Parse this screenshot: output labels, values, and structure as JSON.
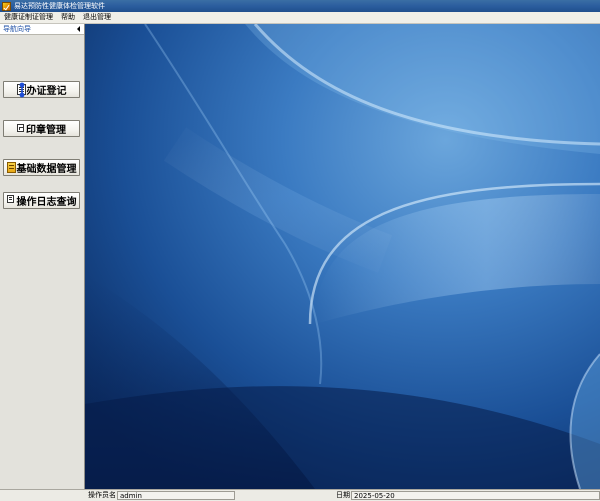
{
  "window": {
    "title": "易达预防性健康体检管理软件",
    "icon": "app-check-icon"
  },
  "menu": {
    "items": [
      {
        "label": "健康证制证管理"
      },
      {
        "label": "帮助"
      },
      {
        "label": "退出管理"
      }
    ]
  },
  "nav": {
    "title": "导航向导",
    "collapse_icon": "collapse-left-icon",
    "buttons": [
      {
        "label": "办证登记",
        "icon": "id-card-icon"
      },
      {
        "label": "印章管理",
        "icon": "stamp-icon"
      },
      {
        "label": "基础数据管理",
        "icon": "database-icon"
      },
      {
        "label": "操作日志查询",
        "icon": "log-icon"
      }
    ]
  },
  "status": {
    "operator_label": "操作员名",
    "operator_value": "admin",
    "date_label": "日期",
    "date_value": "2025-05-20"
  },
  "colors": {
    "title_bar": "#2b5d9e",
    "desktop_blue": "#1e5aa8",
    "nav_panel": "#e3e2dc",
    "nav_title": "#1d4fa5"
  }
}
